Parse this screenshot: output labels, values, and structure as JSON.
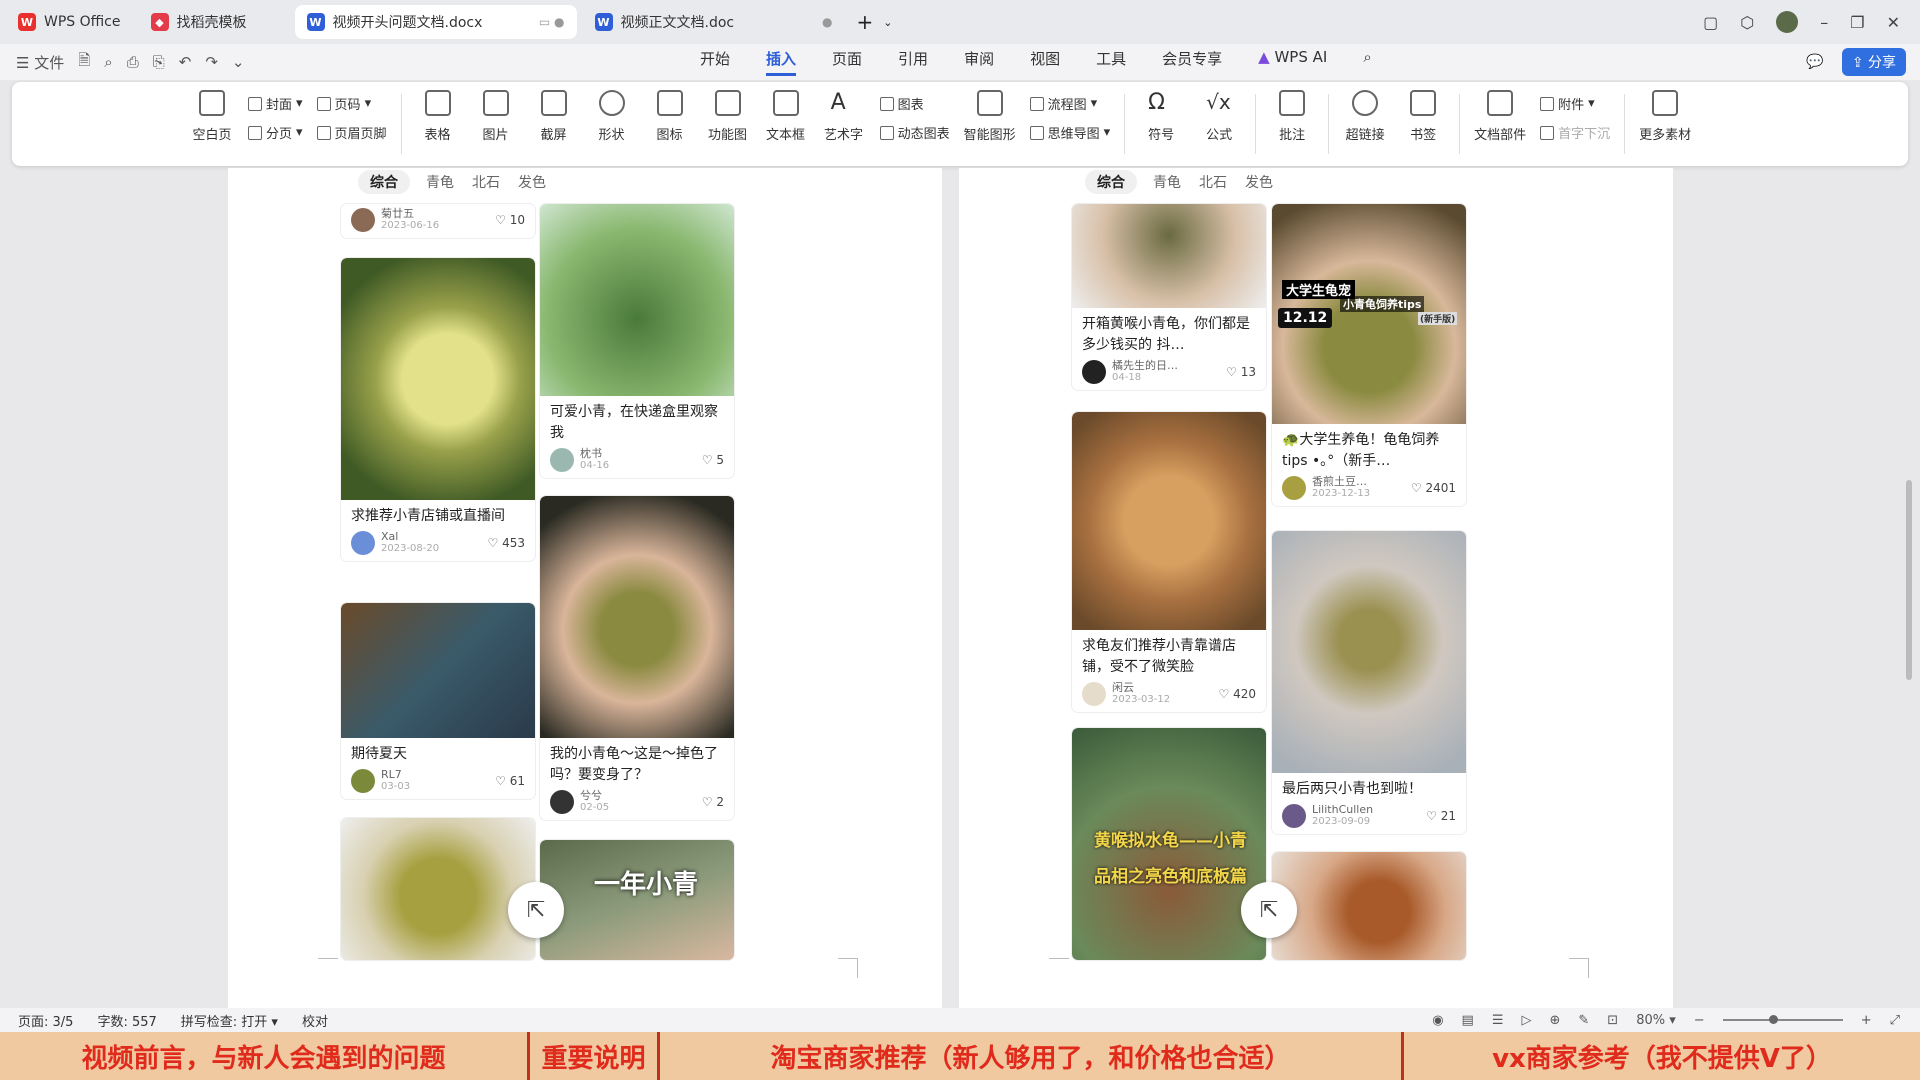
{
  "tabs": [
    {
      "label": "WPS Office",
      "icon": "wps-logo-icon"
    },
    {
      "label": "找稻壳模板",
      "icon": "docer-icon"
    },
    {
      "label": "视频开头问题文档.docx",
      "icon": "word-doc-icon",
      "active": true
    },
    {
      "label": "视频正文文档.doc",
      "icon": "word-doc-icon"
    }
  ],
  "menu": {
    "file": "文件",
    "tabs": [
      "开始",
      "插入",
      "页面",
      "引用",
      "审阅",
      "视图",
      "工具",
      "会员专享"
    ],
    "active": "插入",
    "wps_ai": "WPS AI",
    "share": "分享"
  },
  "ribbon": {
    "single": [
      [
        "空白页",
        "page-icon"
      ],
      [
        "表格",
        "table-icon"
      ],
      [
        "图片",
        "image-icon"
      ],
      [
        "截屏",
        "screenshot-icon"
      ],
      [
        "形状",
        "shape-icon"
      ],
      [
        "图标",
        "icons-icon"
      ],
      [
        "功能图",
        "function-chart-icon"
      ],
      [
        "文本框",
        "textbox-icon"
      ],
      [
        "艺术字",
        "wordart-icon"
      ]
    ],
    "pairs": [
      [
        "封面",
        "分页"
      ],
      [
        "页码",
        "页眉页脚"
      ]
    ],
    "chart": [
      "图表",
      "动态图表"
    ],
    "smart": "智能图形",
    "flow": [
      "流程图",
      "思维导图"
    ],
    "more": [
      [
        "符号",
        "symbol-icon"
      ],
      [
        "公式",
        "formula-icon"
      ],
      [
        "批注",
        "comment-icon"
      ],
      [
        "超链接",
        "link-icon"
      ],
      [
        "书签",
        "bookmark-icon"
      ],
      [
        "文档部件",
        "doc-part-icon"
      ]
    ],
    "attach": [
      "附件",
      "首字下沉"
    ],
    "material": "更多素材"
  },
  "chips": [
    "综合",
    "青龟",
    "北石",
    "发色"
  ],
  "left_page": {
    "cards": [
      {
        "title": "",
        "user": "菊廿五",
        "date": "2023-06-16",
        "likes": "10"
      },
      {
        "title": "求推荐小青店铺或直播间",
        "user": "Xal",
        "date": "2023-08-20",
        "likes": "453"
      },
      {
        "title": "期待夏天",
        "user": "RL7",
        "date": "03-03",
        "likes": "61"
      },
      {
        "title": "可爱小青，在快递盒里观察我",
        "user": "枕书",
        "date": "04-16",
        "likes": "5"
      },
      {
        "title": "我的小青龟～这是～掉色了吗？要变身了？",
        "user": "兮兮",
        "date": "02-05",
        "likes": "2"
      }
    ],
    "overlay": "一年小青"
  },
  "right_page": {
    "cards": [
      {
        "title": "开箱黄喉小青龟，你们都是多少钱买的 抖…",
        "user": "橘先生的日…",
        "date": "04-18",
        "likes": "13"
      },
      {
        "title": "求龟友们推荐小青靠谱店铺，受不了微笑脸",
        "user": "闲云",
        "date": "2023-03-12",
        "likes": "420"
      },
      {
        "title": "🐢大学生养龟！龟龟饲养tips •｡°（新手…",
        "user": "香煎土豆…",
        "date": "2023-12-13",
        "likes": "2401"
      },
      {
        "title": "最后两只小青也到啦！",
        "user": "LilithCullen",
        "date": "2023-09-09",
        "likes": "21"
      }
    ],
    "overlays": {
      "a": "大学生龟宠",
      "b": "小青龟饲养tips",
      "c": "(新手版)",
      "d": "12.12",
      "e": "黄喉拟水龟——小青",
      "f": "品相之亮色和底板篇"
    }
  },
  "status": {
    "page": "页面: 3/5",
    "words": "字数: 557",
    "spell": "拼写检查: 打开",
    "proof": "校对",
    "zoom": "80%"
  },
  "subtitles": [
    "视频前言，与新人会遇到的问题",
    "重要说明",
    "淘宝商家推荐（新人够用了，和价格也合适）",
    "vx商家参考（我不提供V了）"
  ]
}
